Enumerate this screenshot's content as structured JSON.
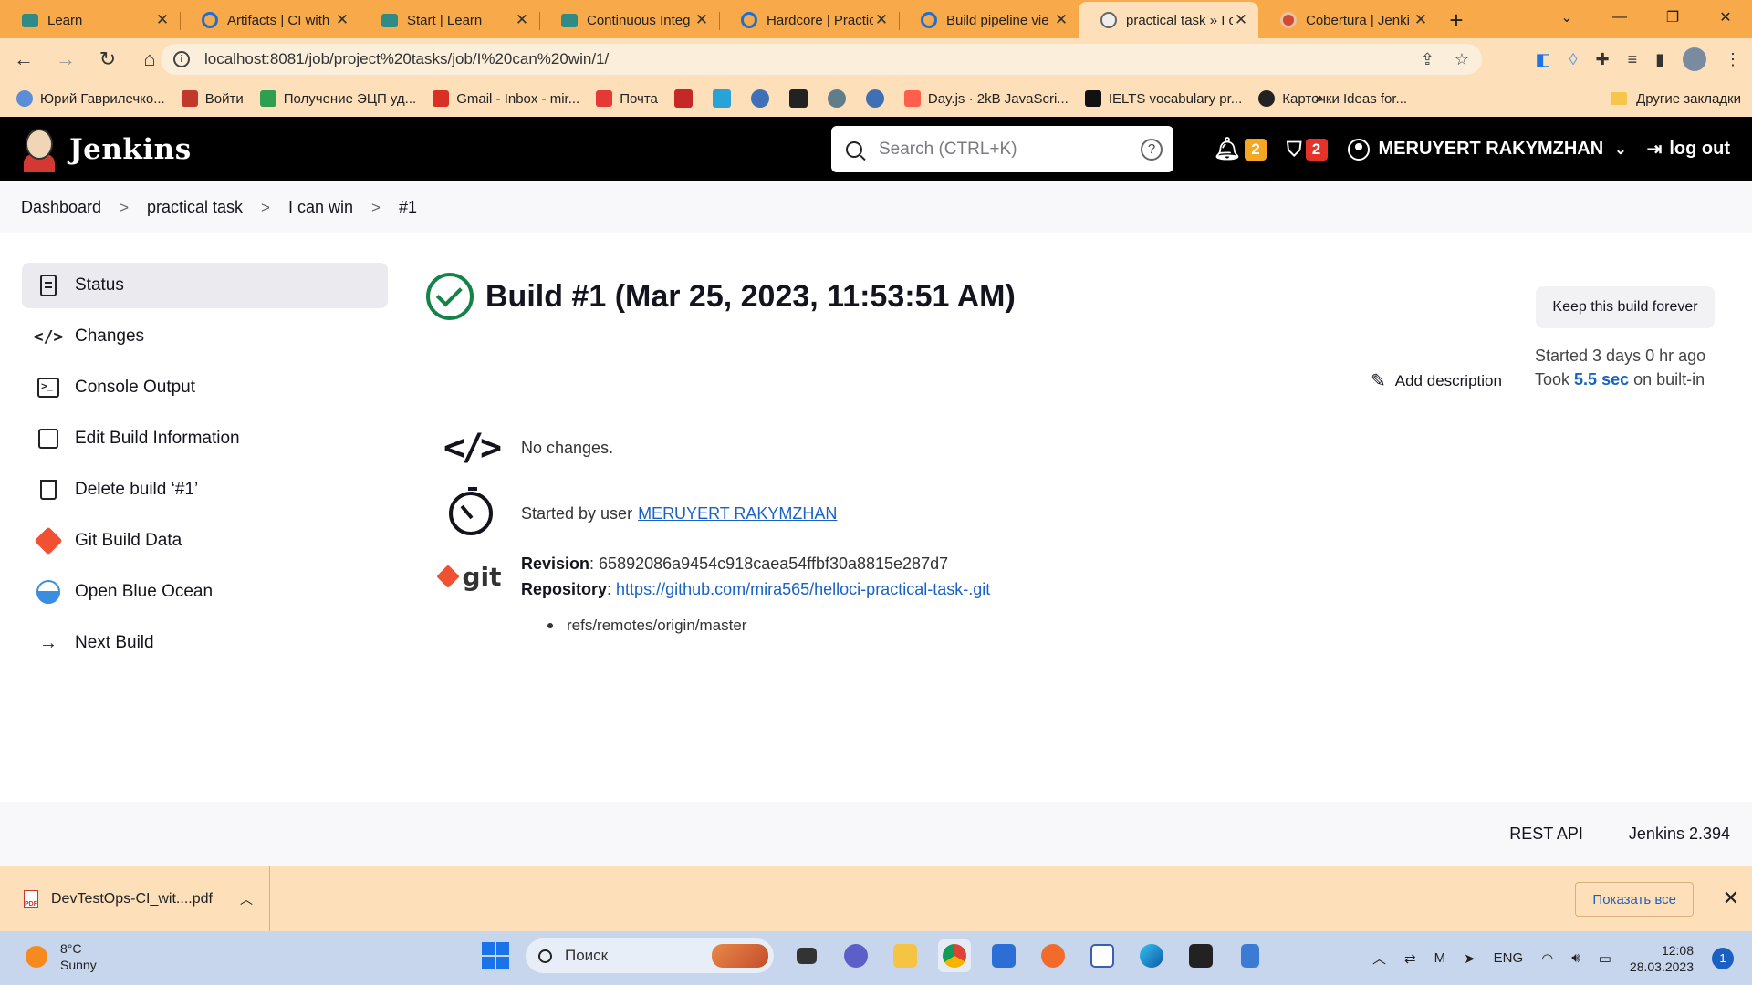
{
  "browser": {
    "tabs": [
      {
        "title": "Learn",
        "icon": "learn-icon",
        "active": false
      },
      {
        "title": "Artifacts | CI with",
        "icon": "circle-icon",
        "active": false
      },
      {
        "title": "Start | Learn",
        "icon": "learn-icon",
        "active": false
      },
      {
        "title": "Continuous Integ",
        "icon": "learn-icon",
        "active": false
      },
      {
        "title": "Hardcore | Practic",
        "icon": "circle-icon",
        "active": false
      },
      {
        "title": "Build pipeline vie",
        "icon": "circle-icon",
        "active": false
      },
      {
        "title": "practical task » I c",
        "icon": "jenkins-icon",
        "active": true
      },
      {
        "title": "Cobertura | Jenki",
        "icon": "jenkins-icon",
        "active": false
      }
    ],
    "url": "localhost:8081/job/project%20tasks/job/I%20can%20win/1/",
    "bookmarks": [
      {
        "label": "Юрий Гаврилечко...",
        "color": "#5b8dd9"
      },
      {
        "label": "Войти",
        "color": "#c0392b"
      },
      {
        "label": "Получение ЭЦП уд...",
        "color": "#2e9e4f"
      },
      {
        "label": "Gmail - Inbox - mir...",
        "color": "#d93025"
      },
      {
        "label": "Почта",
        "color": "#e53935"
      }
    ],
    "bookmark_icons": [
      "#c62828",
      "#29a3d6",
      "#3f6fb5",
      "#222222",
      "#607d8b",
      "#3f6fb5"
    ],
    "bookmarks_after": [
      {
        "label": "Day.js · 2kB JavaScri...",
        "color": "#ff5f4c"
      },
      {
        "label": "IELTS vocabulary pr...",
        "color": "#111111"
      },
      {
        "label": "Карточки Ideas for...",
        "color": "#222222"
      }
    ],
    "bookmarks_more": "»",
    "other_bookmarks": "Другие закладки"
  },
  "jenkins": {
    "brand": "Jenkins",
    "search_placeholder": "Search (CTRL+K)",
    "notifications_count": "2",
    "security_count": "2",
    "user_name": "MERUYERT RAKYMZHAN",
    "logout_label": "log out"
  },
  "breadcrumb": [
    "Dashboard",
    "practical task",
    "I can win",
    "#1"
  ],
  "sidebar": {
    "items": [
      {
        "label": "Status",
        "icon": "status-icon"
      },
      {
        "label": "Changes",
        "icon": "code-icon"
      },
      {
        "label": "Console Output",
        "icon": "terminal-icon"
      },
      {
        "label": "Edit Build Information",
        "icon": "edit-icon"
      },
      {
        "label": "Delete build ‘#1’",
        "icon": "trash-icon"
      },
      {
        "label": "Git Build Data",
        "icon": "git-icon"
      },
      {
        "label": "Open Blue Ocean",
        "icon": "blue-ocean-icon"
      },
      {
        "label": "Next Build",
        "icon": "arrow-right-icon"
      }
    ]
  },
  "build": {
    "title": "Build #1 (Mar 25, 2023, 11:53:51 AM)",
    "status_color": "#138347",
    "keep_label": "Keep this build forever",
    "started_ago": "Started 3 days 0 hr ago",
    "took_prefix": "Took",
    "took_duration": "5.5 sec",
    "took_suffix": "on built-in",
    "add_description": "Add description",
    "changes_text": "No changes.",
    "started_by_prefix": "Started by user",
    "started_by_user": "MERUYERT RAKYMZHAN",
    "git_word": "git",
    "revision_label": "Revision",
    "revision_value": "65892086a9454c918caea54ffbf30a8815e287d7",
    "repository_label": "Repository",
    "repository_url": "https://github.com/mira565/helloci-practical-task-.git",
    "branch": "refs/remotes/origin/master"
  },
  "footer": {
    "rest_api": "REST API",
    "version": "Jenkins 2.394"
  },
  "downloads": {
    "file_name": "DevTestOps-CI_wit....pdf",
    "show_all": "Показать все"
  },
  "taskbar": {
    "temperature": "8°C",
    "weather": "Sunny",
    "search_placeholder": "Поиск",
    "language": "ENG",
    "time": "12:08",
    "date": "28.03.2023",
    "notifications": "1"
  }
}
